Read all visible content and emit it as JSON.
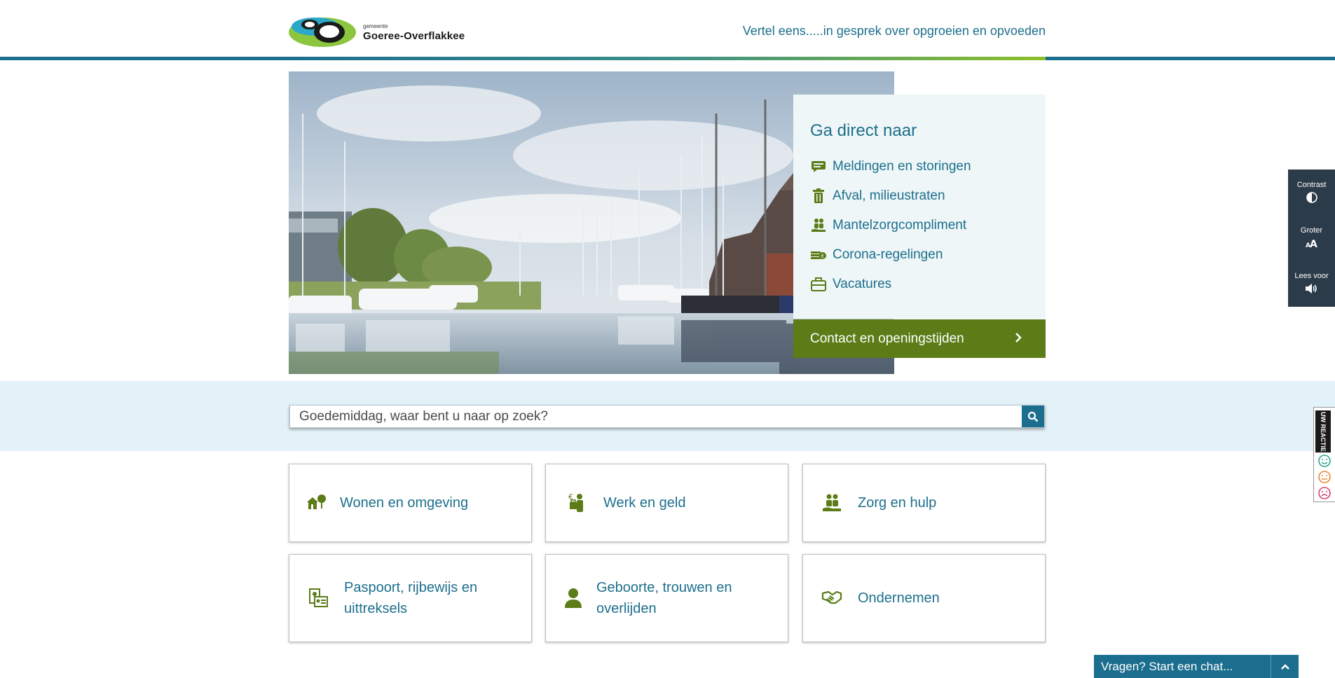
{
  "header": {
    "logo_small": "gemeente",
    "logo_name": "Goeree-Overflakkee",
    "tagline_link": "Vertel eens.....in gesprek over opgroeien en opvoeden"
  },
  "quick_links": {
    "title": "Ga direct naar",
    "items": [
      {
        "label": "Meldingen en storingen",
        "icon": "message-icon"
      },
      {
        "label": "Afval, milieustraten",
        "icon": "trash-icon"
      },
      {
        "label": "Mantelzorgcompliment",
        "icon": "care-hand-icon"
      },
      {
        "label": "Corona-regelingen",
        "icon": "money-icon"
      },
      {
        "label": "Vacatures",
        "icon": "briefcase-icon"
      }
    ],
    "contact_label": "Contact en openingstijden"
  },
  "search": {
    "placeholder": "Goedemiddag, waar bent u naar op zoek?"
  },
  "tiles": [
    {
      "label": "Wonen en omgeving",
      "icon": "house-tree-icon"
    },
    {
      "label": "Werk en geld",
      "icon": "work-money-icon"
    },
    {
      "label": "Zorg en hulp",
      "icon": "care-hand-icon"
    },
    {
      "label": "Paspoort, rijbewijs en uittreksels",
      "icon": "id-document-icon"
    },
    {
      "label": "Geboorte, trouwen en overlijden",
      "icon": "person-icon"
    },
    {
      "label": "Ondernemen",
      "icon": "handshake-icon"
    }
  ],
  "accessibility": {
    "contrast": "Contrast",
    "larger": "Groter",
    "read_aloud": "Lees voor"
  },
  "feedback": {
    "label": "UW REACTIE"
  },
  "chat": {
    "label": "Vragen? Start een chat..."
  },
  "colors": {
    "primary_blue": "#1c6e8f",
    "accent_green": "#5b7c17",
    "quick_bg": "#eef6f8",
    "search_band": "#e3f1f9",
    "a11y_bg": "#2c3b4a"
  }
}
